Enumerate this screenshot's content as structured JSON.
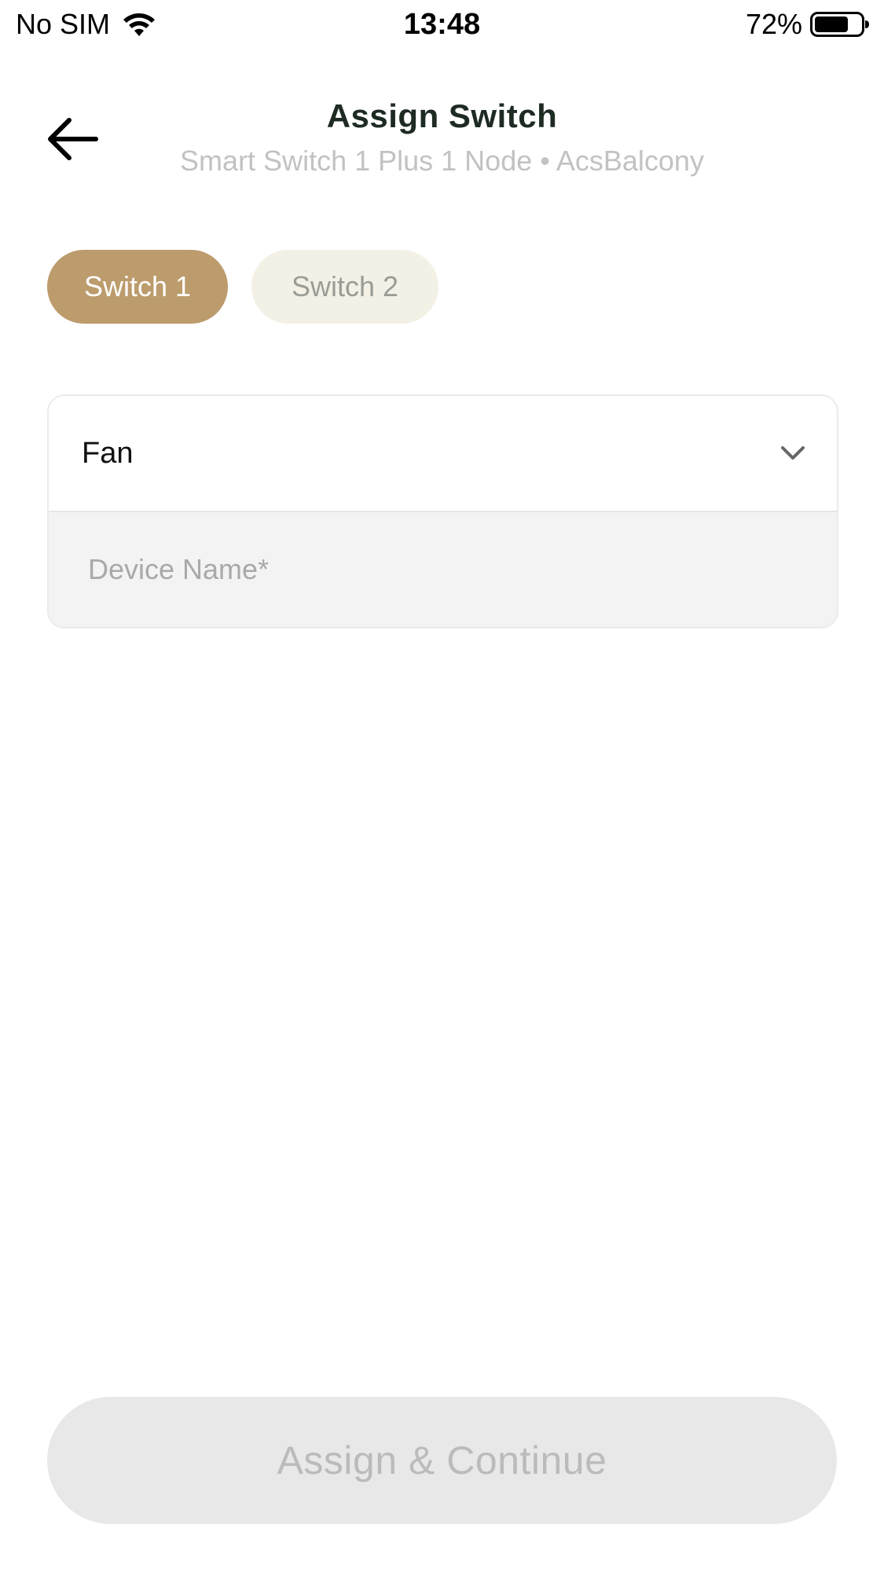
{
  "status_bar": {
    "carrier": "No SIM",
    "time": "13:48",
    "battery": "72%",
    "battery_level": 0.72,
    "icons": [
      "wifi-icon",
      "battery-icon"
    ]
  },
  "header": {
    "back_icon": "arrow-left-icon",
    "title": "Assign Switch",
    "subtitle": "Smart Switch 1 Plus 1 Node • AcsBalcony"
  },
  "tabs": [
    {
      "label": "Switch 1",
      "active": true
    },
    {
      "label": "Switch 2",
      "active": false
    }
  ],
  "form": {
    "device_type": {
      "selected": "Fan",
      "icon": "chevron-down-icon"
    },
    "device_name": {
      "value": "",
      "placeholder": "Device Name*"
    }
  },
  "actions": {
    "assign_label": "Assign & Continue",
    "assign_enabled": false
  },
  "colors": {
    "accent": "#bc9b6c",
    "tab_inactive_bg": "#f3f1e6",
    "title": "#1e2b23",
    "subtitle": "#c2c2c2",
    "button_disabled_bg": "#e7e8e7",
    "button_disabled_text": "#bbbbbb"
  }
}
